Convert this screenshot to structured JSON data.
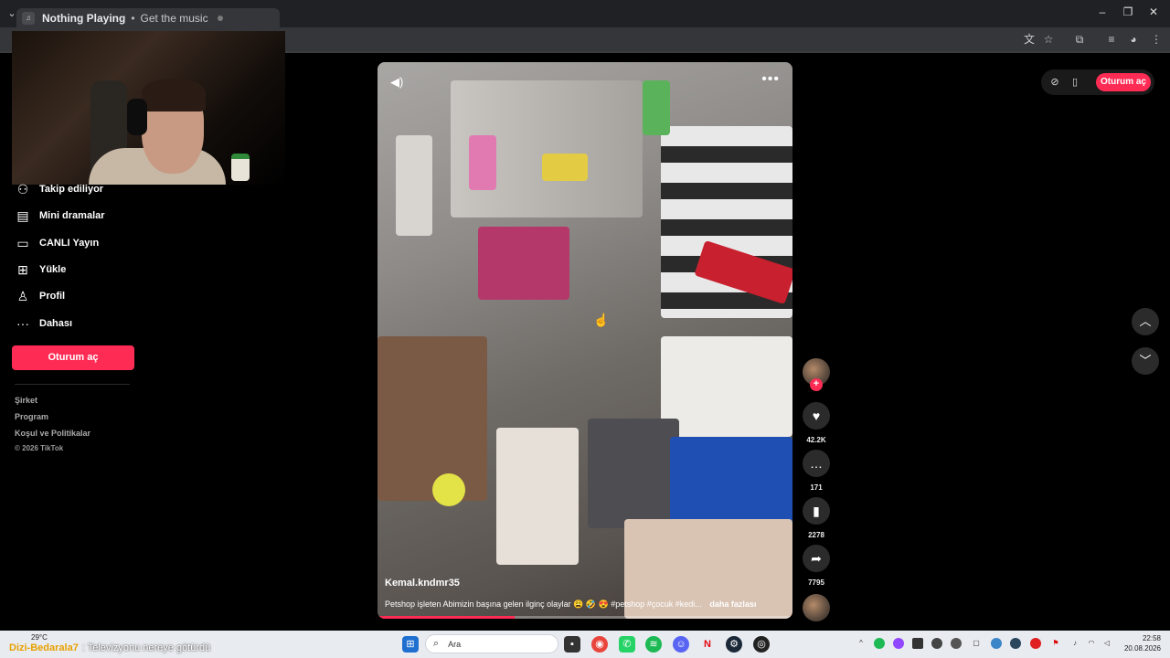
{
  "browser": {
    "tab_title": "Nothing Playing",
    "tab_separator": "•",
    "tab_subtitle": "Get the music",
    "min": "–",
    "restore": "❐",
    "close": "✕"
  },
  "sidebar": {
    "items": [
      {
        "label": "Takip ediliyor",
        "icon": "people-icon"
      },
      {
        "label": "Mini dramalar",
        "icon": "film-icon"
      },
      {
        "label": "CANLI Yayın",
        "icon": "tv-icon"
      },
      {
        "label": "Yükle",
        "icon": "plus-square-icon"
      },
      {
        "label": "Profil",
        "icon": "person-icon"
      },
      {
        "label": "Dahası",
        "icon": "ellipsis-icon"
      }
    ],
    "login_label": "Oturum aç",
    "footer": [
      "Şirket",
      "Program",
      "Koşul ve Politikalar"
    ],
    "copyright": "© 2026 TikTok"
  },
  "video": {
    "author": "Kemal.kndmr35",
    "caption": "Petshop işleten Abimizin başına gelen ilginç olaylar 😩 🤣 😍 #petshop #çocuk #kedi...",
    "caption_more": "daha fazlası",
    "progress": 0.33
  },
  "actions": {
    "likes": "42.2K",
    "comments": "171",
    "saves": "2278",
    "shares": "7795"
  },
  "topbar": {
    "login_label": "Oturum aç"
  },
  "taskbar": {
    "temperature": "29°C",
    "chat_user": "Dizi-Bedarala7",
    "chat_message": ": Televizyonu nereye götürdü",
    "search_placeholder": "Ara",
    "time": "22:58",
    "date": "20.08.2026"
  },
  "colors": {
    "accent": "#fe2c55",
    "background": "#000000"
  }
}
